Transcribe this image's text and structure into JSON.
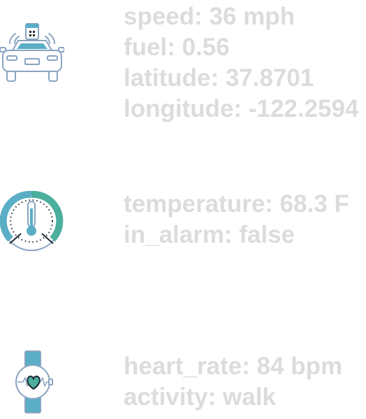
{
  "devices": [
    {
      "icon": "connected-car-icon",
      "readings": [
        "speed: 36 mph",
        "fuel: 0.56",
        "latitude: 37.8701",
        "longitude: -122.2594"
      ]
    },
    {
      "icon": "thermostat-gauge-icon",
      "readings": [
        "temperature: 68.3 F",
        "in_alarm: false"
      ]
    },
    {
      "icon": "smartwatch-heart-icon",
      "readings": [
        "heart_rate: 84 bpm",
        "activity: walk"
      ]
    }
  ],
  "colors": {
    "text": "#dcdcdc",
    "icon_stroke": "#8aa4c2",
    "icon_fill": "#5aaec6",
    "icon_teal": "#4caf9e",
    "icon_dark": "#1f2a36"
  }
}
